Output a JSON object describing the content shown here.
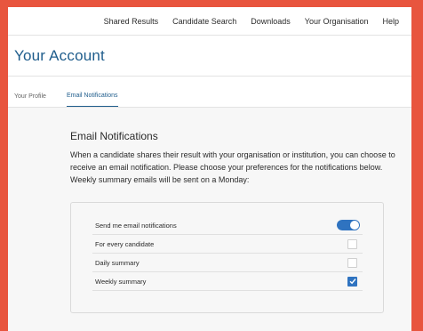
{
  "nav": {
    "items": [
      "Shared Results",
      "Candidate Search",
      "Downloads",
      "Your Organisation",
      "Help"
    ]
  },
  "header": {
    "title": "Your Account"
  },
  "tabs": [
    {
      "label": "Your Profile",
      "active": false
    },
    {
      "label": "Email Notifications",
      "active": true
    }
  ],
  "main": {
    "heading": "Email Notifications",
    "description": "When a candidate shares their result with your organisation or institution, you can choose to receive an email notification. Please choose your preferences for the notifications below. Weekly summary emails will be sent on a Monday:"
  },
  "preferences": {
    "send_label": "Send me email notifications",
    "send_enabled": true,
    "options": [
      {
        "label": "For every candidate",
        "checked": false
      },
      {
        "label": "Daily summary",
        "checked": false
      },
      {
        "label": "Weekly summary",
        "checked": true
      }
    ]
  },
  "colors": {
    "accent": "#2f73c0",
    "title": "#1f5d8c",
    "border_frame": "#e8553e"
  },
  "icons": {
    "checkmark": "check-icon"
  }
}
